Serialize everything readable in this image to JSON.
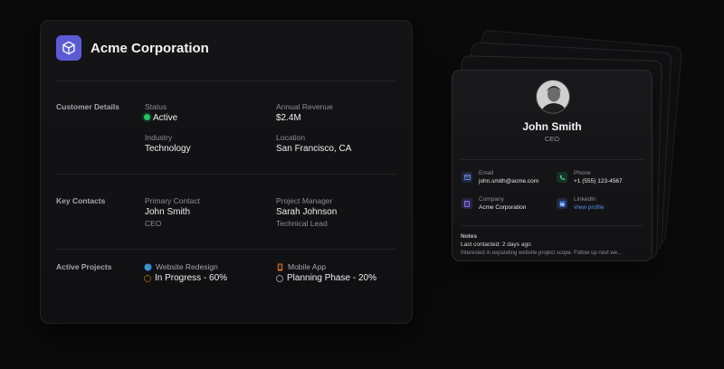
{
  "company": {
    "name": "Acme Corporation",
    "logo_icon": "cube-icon",
    "accent": "#5b5bd6",
    "sections": {
      "customer_details": {
        "label": "Customer Details",
        "status_label": "Status",
        "status_value": "Active",
        "revenue_label": "Annual Revenue",
        "revenue_value": "$2.4M",
        "industry_label": "Industry",
        "industry_value": "Technology",
        "location_label": "Location",
        "location_value": "San Francisco, CA"
      },
      "key_contacts": {
        "label": "Key Contacts",
        "primary_label": "Primary Contact",
        "primary_name": "John Smith",
        "primary_role": "CEO",
        "pm_label": "Project Manager",
        "pm_name": "Sarah Johnson",
        "pm_role": "Technical Lead"
      },
      "active_projects": {
        "label": "Active Projects",
        "projects": [
          {
            "name": "Website Redesign",
            "icon": "globe-icon",
            "status": "In Progress - 60%"
          },
          {
            "name": "Mobile App",
            "icon": "mobile-phone-icon",
            "status": "Planning Phase - 20%"
          }
        ]
      }
    }
  },
  "profile": {
    "name": "John Smith",
    "role": "CEO",
    "email_label": "Email",
    "email_value": "john.smith@acme.com",
    "phone_label": "Phone",
    "phone_value": "+1 (555) 123-4567",
    "company_label": "Company",
    "company_value": "Acme Corporation",
    "linkedin_label": "LinkedIn",
    "linkedin_value": "View profile",
    "notes_label": "Notes",
    "notes_last_contacted": "Last contacted: 2 days ago",
    "notes_text": "Interested in expanding website project scope. Follow up next we..."
  },
  "colors": {
    "status_active": "#22c55e",
    "link": "#5b8def",
    "email_icon_bg": "#1f2a44",
    "phone_icon_bg": "#173224",
    "company_icon_bg": "#2a2446",
    "linkedin_icon_bg": "#1f2a44"
  }
}
